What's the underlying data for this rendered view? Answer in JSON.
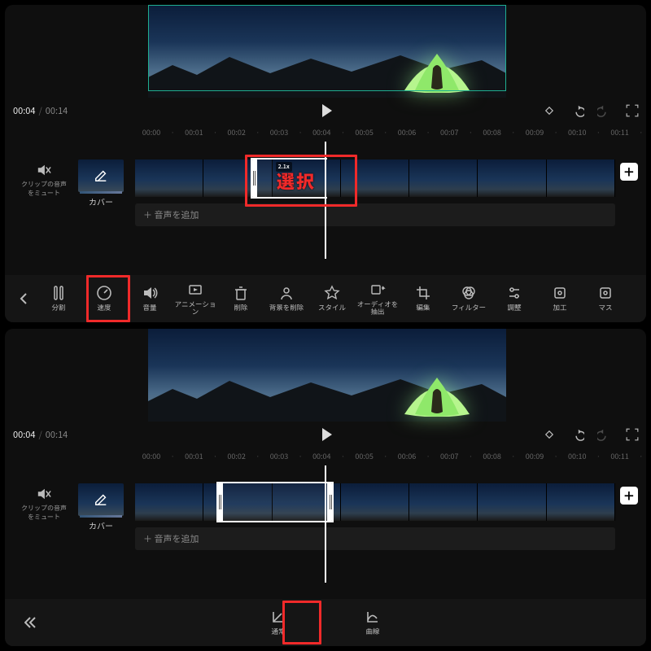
{
  "time": {
    "current": "00:04",
    "total": "00:14"
  },
  "ruler": [
    "00:00",
    "00:01",
    "00:02",
    "00:03",
    "00:04",
    "00:05",
    "00:06",
    "00:07",
    "00:08",
    "00:09",
    "00:10",
    "00:11"
  ],
  "mute_label": "クリップの音声をミュート",
  "cover_label": "カバー",
  "audio_add": "＋ 音声を追加",
  "clip_badge": "2.1x",
  "callout_select": "選択",
  "tools_top": [
    {
      "id": "split",
      "label": "分割"
    },
    {
      "id": "speed",
      "label": "速度"
    },
    {
      "id": "volume",
      "label": "音量"
    },
    {
      "id": "animation",
      "label": "アニメーション"
    },
    {
      "id": "delete",
      "label": "削除"
    },
    {
      "id": "bgremove",
      "label": "背景を削除"
    },
    {
      "id": "style",
      "label": "スタイル"
    },
    {
      "id": "audioext",
      "label": "オーディオを抽出"
    },
    {
      "id": "edit",
      "label": "編集"
    },
    {
      "id": "filter",
      "label": "フィルター"
    },
    {
      "id": "adjust",
      "label": "調整"
    },
    {
      "id": "effect",
      "label": "加工"
    },
    {
      "id": "mask",
      "label": "マス"
    }
  ],
  "tools_speed": [
    {
      "id": "normal",
      "label": "通常"
    },
    {
      "id": "curve",
      "label": "曲線"
    }
  ]
}
